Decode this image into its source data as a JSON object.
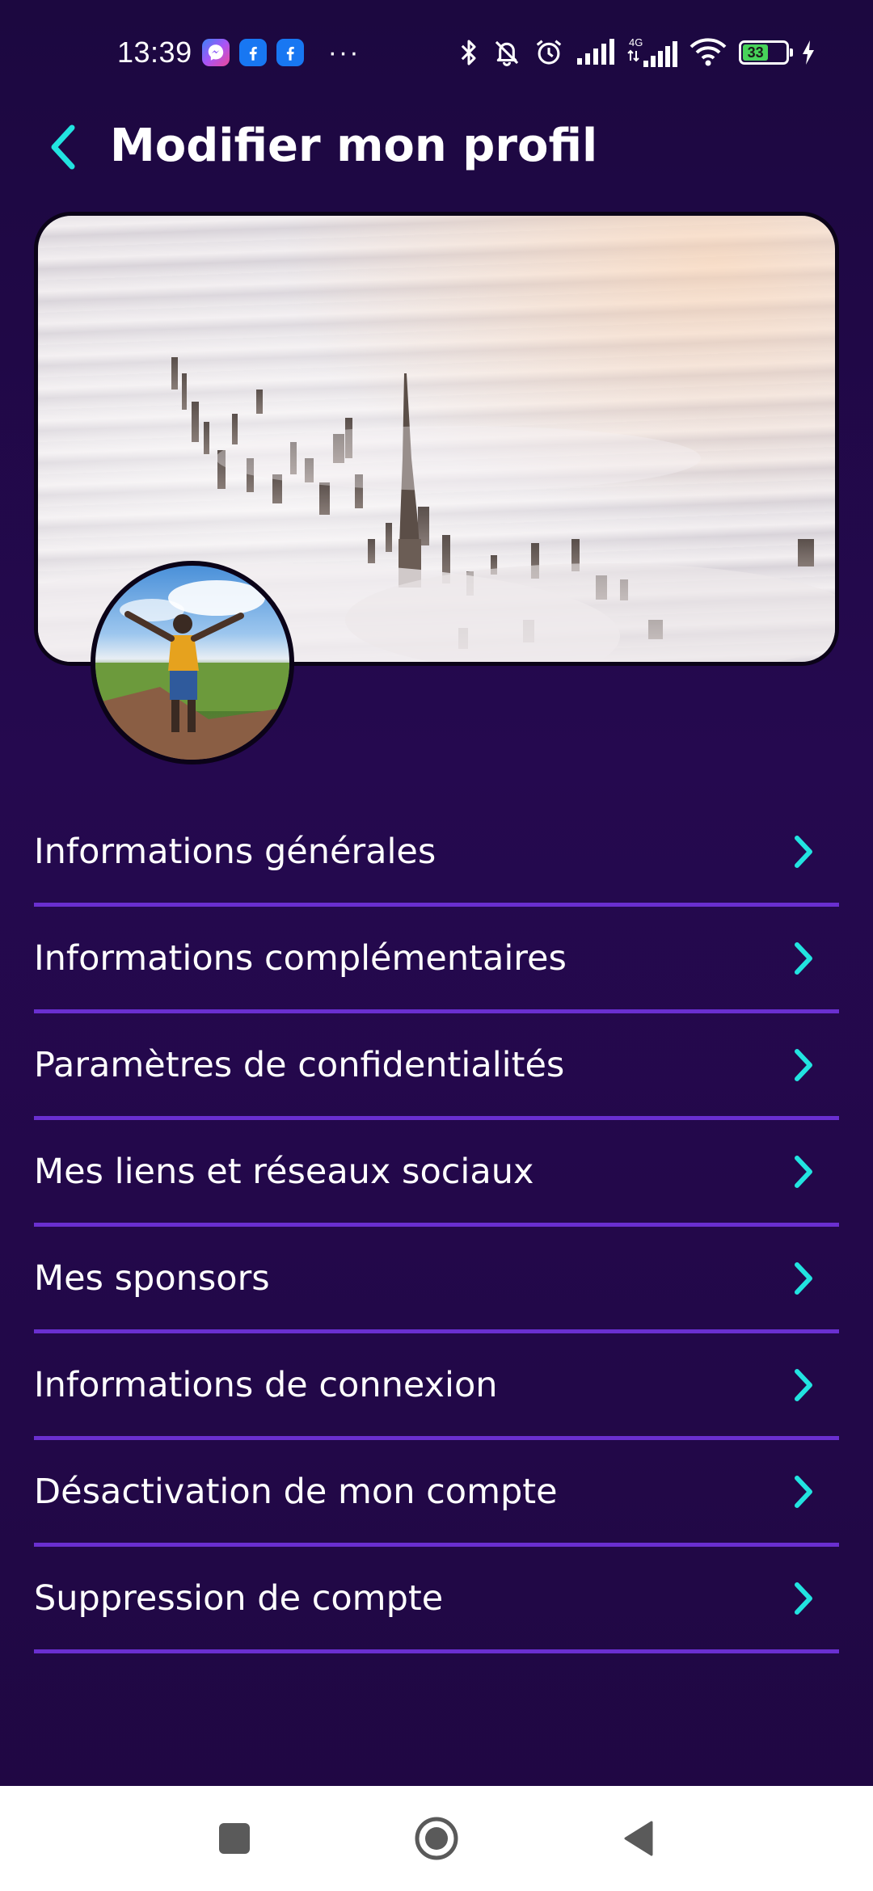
{
  "status_bar": {
    "time": "13:39",
    "overflow": "···",
    "network_label": "4G",
    "battery_level": "33",
    "notification_icons": [
      "messenger-icon",
      "facebook-icon",
      "facebook-icon"
    ],
    "status_icons": [
      "bluetooth-icon",
      "bell-off-icon",
      "alarm-icon",
      "signal-icon",
      "signal-4g-icon",
      "wifi-icon",
      "battery-icon",
      "charging-icon"
    ]
  },
  "header": {
    "title": "Modifier mon profil",
    "back_icon": "chevron-left-icon"
  },
  "menu": {
    "items": [
      {
        "label": "Informations générales"
      },
      {
        "label": "Informations complémentaires"
      },
      {
        "label": "Paramètres de confidentialités"
      },
      {
        "label": "Mes liens et réseaux sociaux"
      },
      {
        "label": "Mes sponsors"
      },
      {
        "label": "Informations de connexion"
      },
      {
        "label": "Désactivation de mon compte"
      },
      {
        "label": "Suppression de compte"
      }
    ],
    "item_icon": "chevron-right-icon"
  },
  "nav_bar": {
    "buttons": [
      "recents-square-icon",
      "home-circle-icon",
      "back-triangle-icon"
    ]
  },
  "colors": {
    "background": "#220848",
    "accent": "#22e3e0",
    "divider": "#6a2fd0",
    "text": "#ffffff"
  }
}
